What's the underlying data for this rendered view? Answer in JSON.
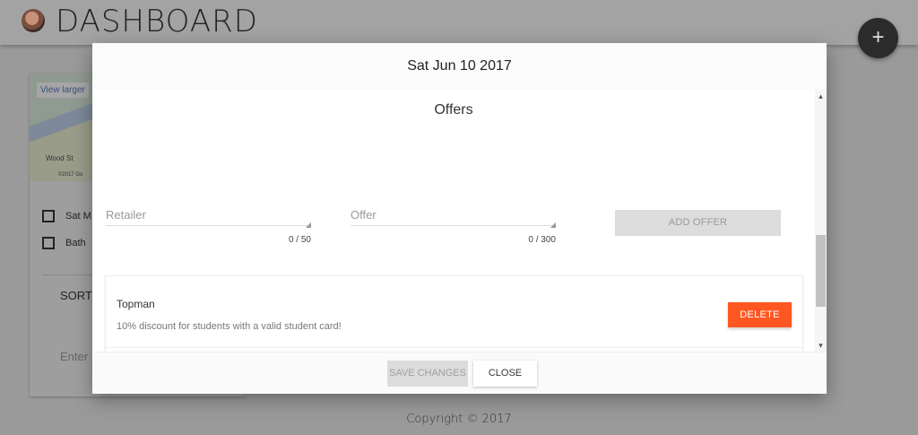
{
  "app": {
    "title": "DASHBOARD",
    "fab_label": "+",
    "copyright": "Copyright © 2017"
  },
  "background_card": {
    "map_link": "View larger",
    "map_street": "Wood St",
    "map_copyright": "©2017 Go",
    "date_row": "Sat M",
    "location_row": "Bath",
    "sort_label": "SORT",
    "input_placeholder": "Enter"
  },
  "modal": {
    "title": "Sat Jun 10 2017",
    "section_title": "Offers",
    "retailer_field": {
      "placeholder": "Retailer",
      "value": "",
      "counter": "0 / 50"
    },
    "offer_field": {
      "placeholder": "Offer",
      "value": "",
      "counter": "0 / 300"
    },
    "add_offer_label": "ADD OFFER",
    "offers": [
      {
        "retailer": "Topman",
        "text": "10% discount for students with a valid student card!",
        "delete_label": "DELETE"
      }
    ],
    "save_label": "SAVE CHANGES",
    "close_label": "CLOSE"
  },
  "colors": {
    "accent": "#ff5722",
    "overlay": "#9a9a9a",
    "disabled_button": "#dcdcdc"
  },
  "icons": {
    "scroll_up": "▴",
    "scroll_down": "▾",
    "resize_grip": "◢"
  }
}
